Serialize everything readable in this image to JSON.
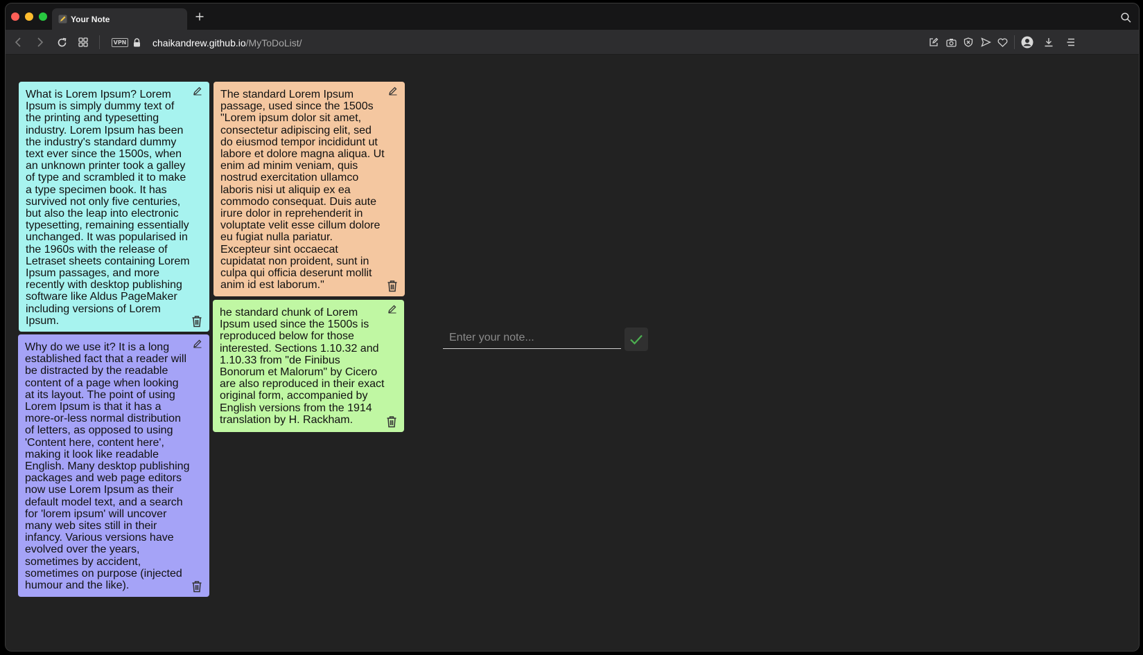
{
  "browser": {
    "tab_title": "Your Note",
    "url_host": "chaikandrew.github.io",
    "url_path": "/MyToDoList/",
    "vpn_label": "VPN"
  },
  "notes": [
    {
      "text": "What is Lorem Ipsum? Lorem Ipsum is simply dummy text of the printing and typesetting industry. Lorem Ipsum has been the industry's standard dummy text ever since the 1500s, when an unknown printer took a galley of type and scrambled it to make a type specimen book. It has survived not only five centuries, but also the leap into electronic typesetting, remaining essentially unchanged. It was popularised in the 1960s with the release of Letraset sheets containing Lorem Ipsum passages, and more recently with desktop publishing software like Aldus PageMaker including versions of Lorem Ipsum.",
      "color": "#a7f3ef"
    },
    {
      "text": "The standard Lorem Ipsum passage, used since the 1500s \"Lorem ipsum dolor sit amet, consectetur adipiscing elit, sed do eiusmod tempor incididunt ut labore et dolore magna aliqua. Ut enim ad minim veniam, quis nostrud exercitation ullamco laboris nisi ut aliquip ex ea commodo consequat. Duis aute irure dolor in reprehenderit in voluptate velit esse cillum dolore eu fugiat nulla pariatur. Excepteur sint occaecat cupidatat non proident, sunt in culpa qui officia deserunt mollit anim id est laborum.\"",
      "color": "#f4c7a0"
    },
    {
      "text": "Why do we use it? It is a long established fact that a reader will be distracted by the readable content of a page when looking at its layout. The point of using Lorem Ipsum is that it has a more-or-less normal distribution of letters, as opposed to using 'Content here, content here', making it look like readable English. Many desktop publishing packages and web page editors now use Lorem Ipsum as their default model text, and a search for 'lorem ipsum' will uncover many web sites still in their infancy. Various versions have evolved over the years, sometimes by accident, sometimes on purpose (injected humour and the like).",
      "color": "#a5a3f7"
    },
    {
      "text": "he standard chunk of Lorem Ipsum used since the 1500s is reproduced below for those interested. Sections 1.10.32 and 1.10.33 from \"de Finibus Bonorum et Malorum\" by Cicero are also reproduced in their exact original form, accompanied by English versions from the 1914 translation by H. Rackham.",
      "color": "#c0f7a3"
    }
  ],
  "form": {
    "placeholder": "Enter your note...",
    "value": ""
  },
  "accent": "#4caf50"
}
